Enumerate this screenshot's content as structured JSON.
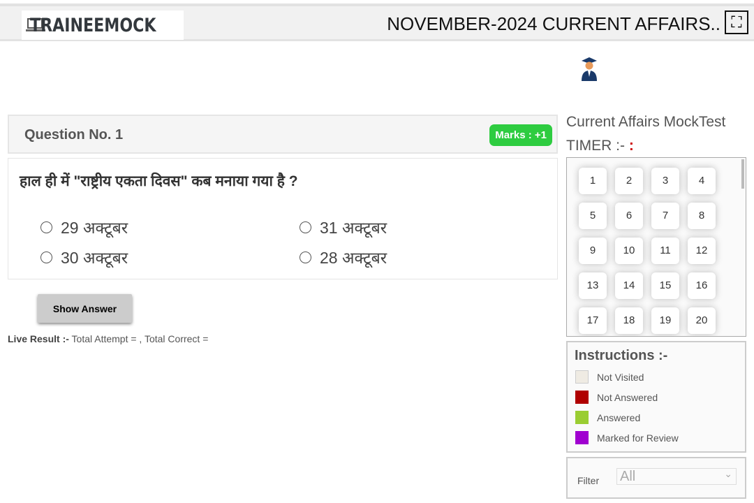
{
  "header": {
    "logo": "TRAINEEMOCK",
    "title": "NOVEMBER-2024 CURRENT AFFAIRS..",
    "fullscreen_icon": "expand-icon"
  },
  "question": {
    "number_label": "Question No. 1",
    "marks": "Marks : +1",
    "text": "हाल ही में \"राष्ट्रीय एकता दिवस\" कब मनाया गया है ?",
    "options": [
      "29 अक्टूबर",
      "31 अक्टूबर",
      "30 अक्टूबर",
      "28 अक्टूबर"
    ]
  },
  "show_answer": "Show Answer",
  "live_result": {
    "label": "Live Result :-",
    "text": "Total Attempt = , Total Correct ="
  },
  "sidebar": {
    "title": "Current Affairs MockTest",
    "timer_label": "TIMER :-",
    "timer_value": ":",
    "questions": [
      "1",
      "2",
      "3",
      "4",
      "5",
      "6",
      "7",
      "8",
      "9",
      "10",
      "11",
      "12",
      "13",
      "14",
      "15",
      "16",
      "17",
      "18",
      "19",
      "20"
    ],
    "instructions": {
      "title": "Instructions :-",
      "items": [
        {
          "label": "Not Visited",
          "color": "#efebe3"
        },
        {
          "label": "Not Answered",
          "color": "#b00000"
        },
        {
          "label": "Answered",
          "color": "#9acd32"
        },
        {
          "label": "Marked for Review",
          "color": "#a000d0"
        }
      ]
    },
    "filter": {
      "label": "Filter",
      "value": "All"
    }
  }
}
